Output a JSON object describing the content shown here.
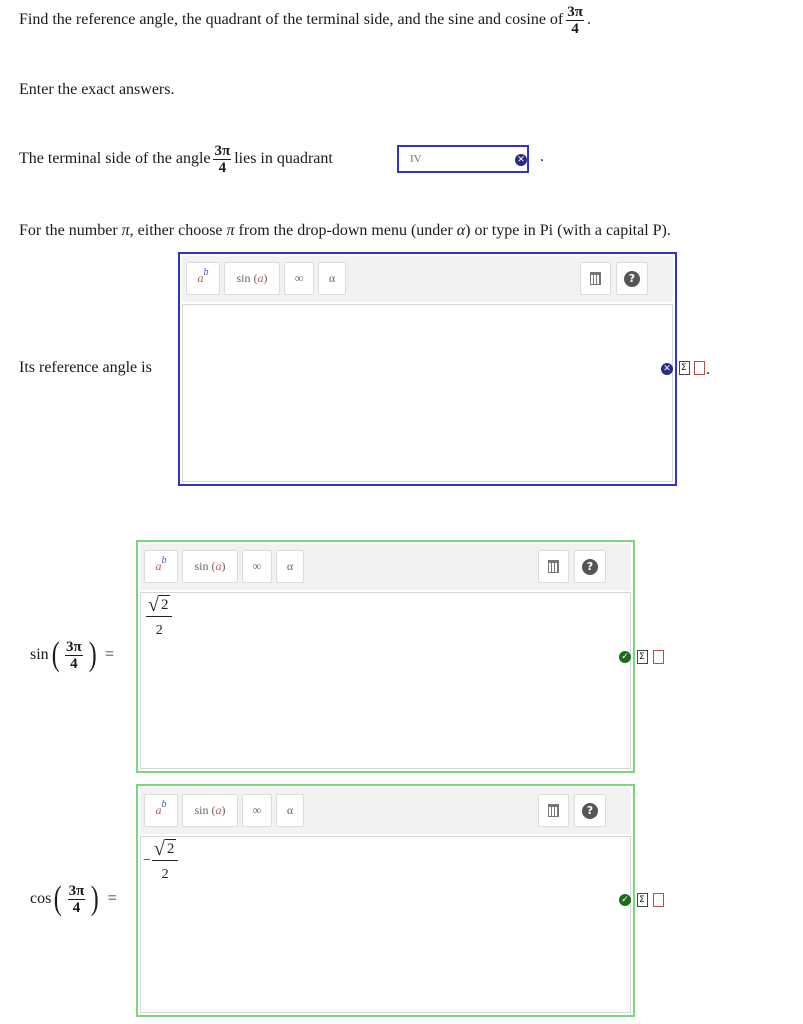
{
  "question": {
    "prompt_prefix": "Find the reference angle, the quadrant of the terminal side, and the sine and cosine of",
    "angle_num": "3π",
    "angle_den": "4",
    "period": ".",
    "instruction": "Enter the exact answers."
  },
  "quadrant": {
    "prefix": "The terminal side of the angle",
    "suffix": "lies in quadrant",
    "selected_value": "IV",
    "after": "."
  },
  "pi_note": {
    "text_a": "For the number",
    "pi": "π",
    "text_b": ", either choose",
    "text_c": "from the drop-down menu (under",
    "alpha": "α",
    "text_d": ") or type in Pi (with a capital P)."
  },
  "reference": {
    "label": "Its reference angle is",
    "answer": "",
    "after": "."
  },
  "toolbar": {
    "power_base": "a",
    "power_exp": "b",
    "sin_fn": "sin",
    "sin_arg": "a",
    "infinity": "∞",
    "alpha": "α",
    "help": "?"
  },
  "sin_row": {
    "fn": "sin",
    "arg_num": "3π",
    "arg_den": "4",
    "equals": "=",
    "answer_num_radicand": "2",
    "answer_den": "2",
    "answer_sign": ""
  },
  "cos_row": {
    "fn": "cos",
    "arg_num": "3π",
    "arg_den": "4",
    "equals": "=",
    "answer_num_radicand": "2",
    "answer_den": "2",
    "answer_sign": "−"
  },
  "colors": {
    "blue_border": "#3333cc",
    "green_border": "#7ad67a",
    "wrong_badge": "#2b2b8a",
    "correct_badge": "#1e6b1e"
  }
}
